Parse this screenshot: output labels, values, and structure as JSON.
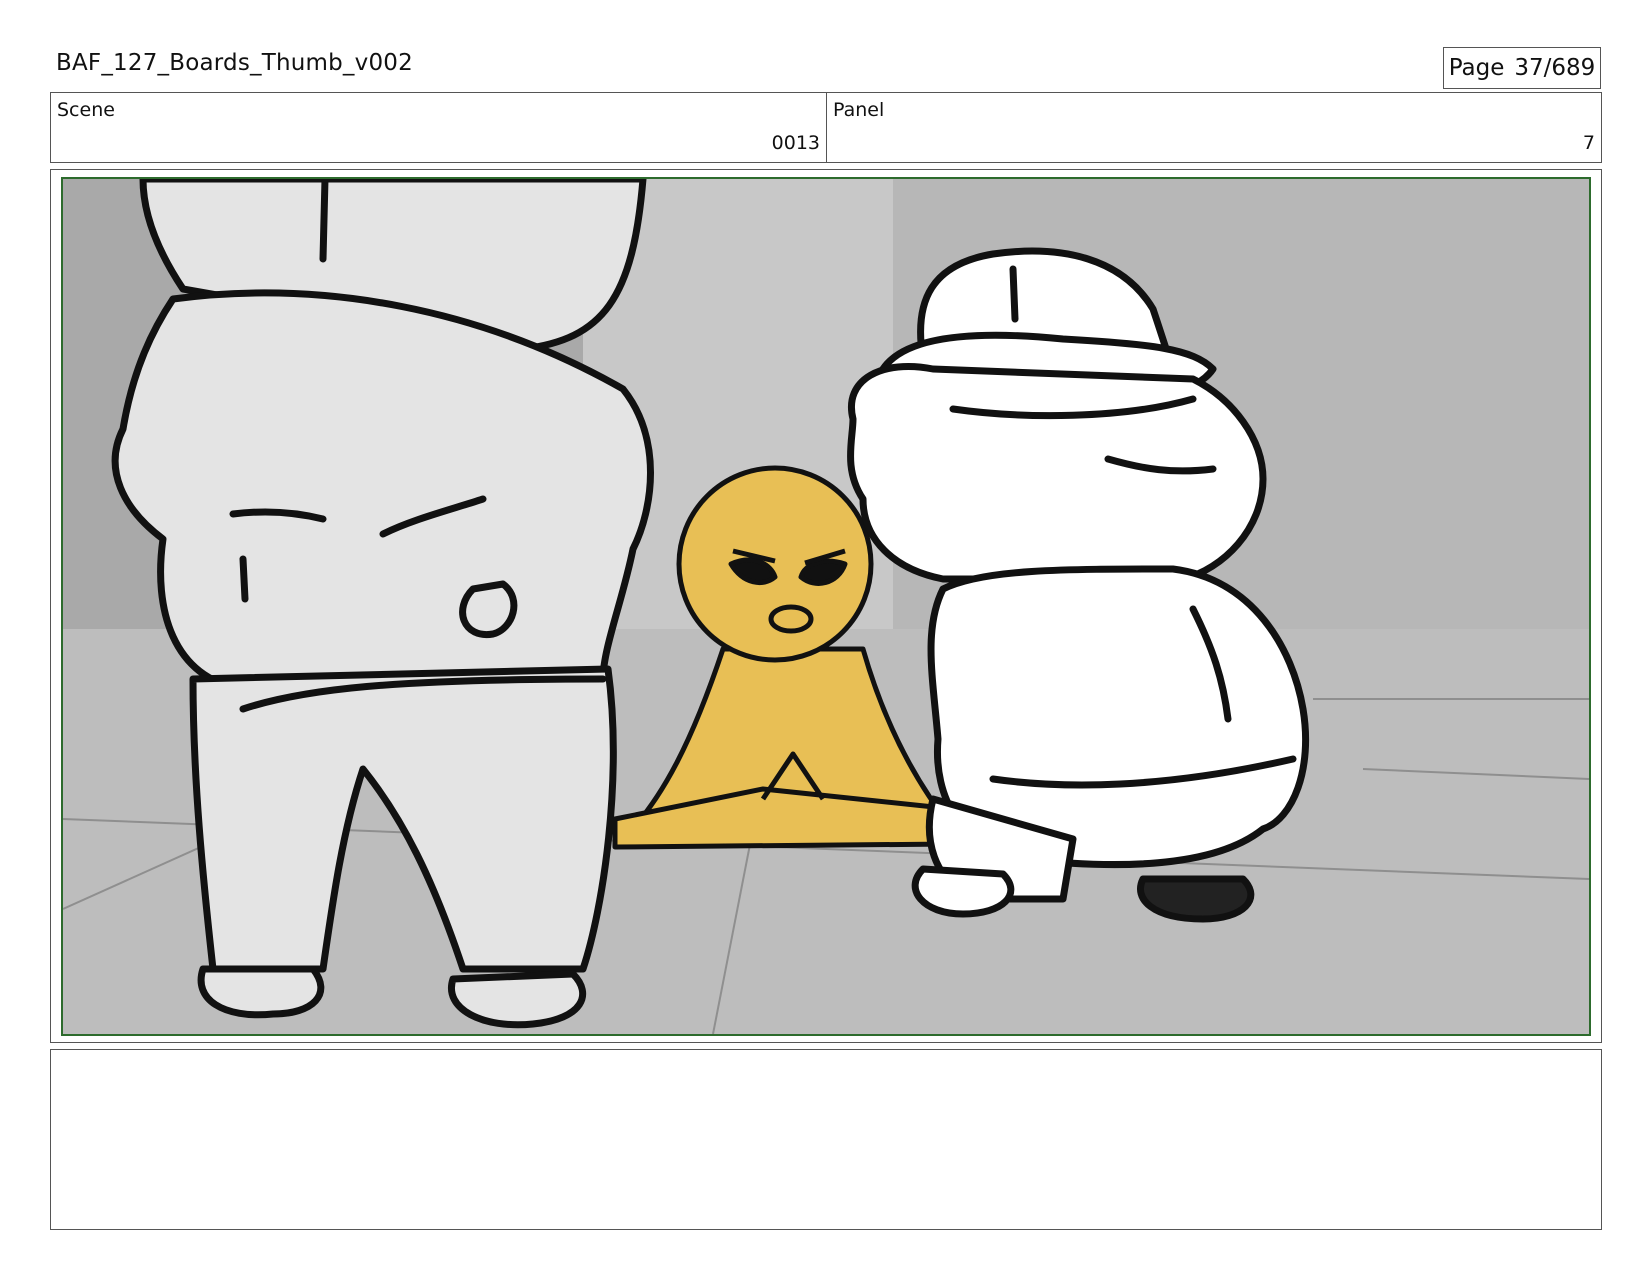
{
  "document": {
    "title": "BAF_127_Boards_Thumb_v002",
    "page_label": "Page",
    "page_number": "37/689"
  },
  "scene": {
    "label": "Scene",
    "value": "0013"
  },
  "panel": {
    "label": "Panel",
    "value": "7"
  },
  "board": {
    "colors": {
      "background": "#b9b9b9",
      "wall": "#c9c9c9",
      "floor": "#bdbdbd",
      "character_left": "#e4e4e4",
      "character_right": "#ffffff",
      "octopus": "#e8bf55",
      "ink": "#111111",
      "frame": "#2d6b2d"
    }
  },
  "notes": {
    "text": ""
  }
}
